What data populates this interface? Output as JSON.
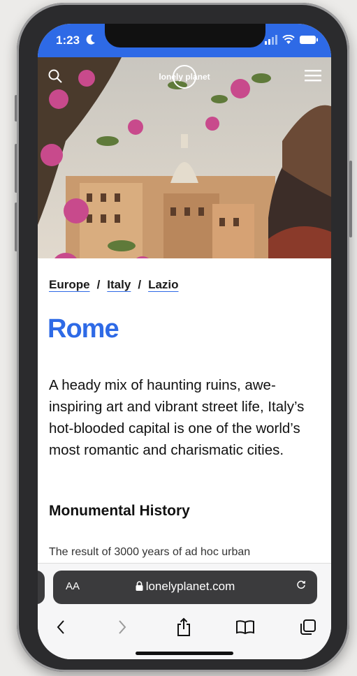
{
  "status_bar": {
    "time": "1:23"
  },
  "site": {
    "logo_text": "lonely planet"
  },
  "breadcrumb": {
    "items": [
      "Europe",
      "Italy",
      "Lazio"
    ],
    "separator": "/"
  },
  "page": {
    "title": "Rome",
    "intro": "A heady mix of haunting ruins, awe-inspiring art and vibrant street life, Italy’s hot-blooded capital is one of the world’s most romantic and charismatic cities.",
    "section_heading": "Monumental History",
    "section_text": "The result of 3000 years of ad hoc urban"
  },
  "browser": {
    "text_size_label": "AA",
    "url": "lonelyplanet.com"
  },
  "colors": {
    "accent": "#2e6ae6"
  }
}
